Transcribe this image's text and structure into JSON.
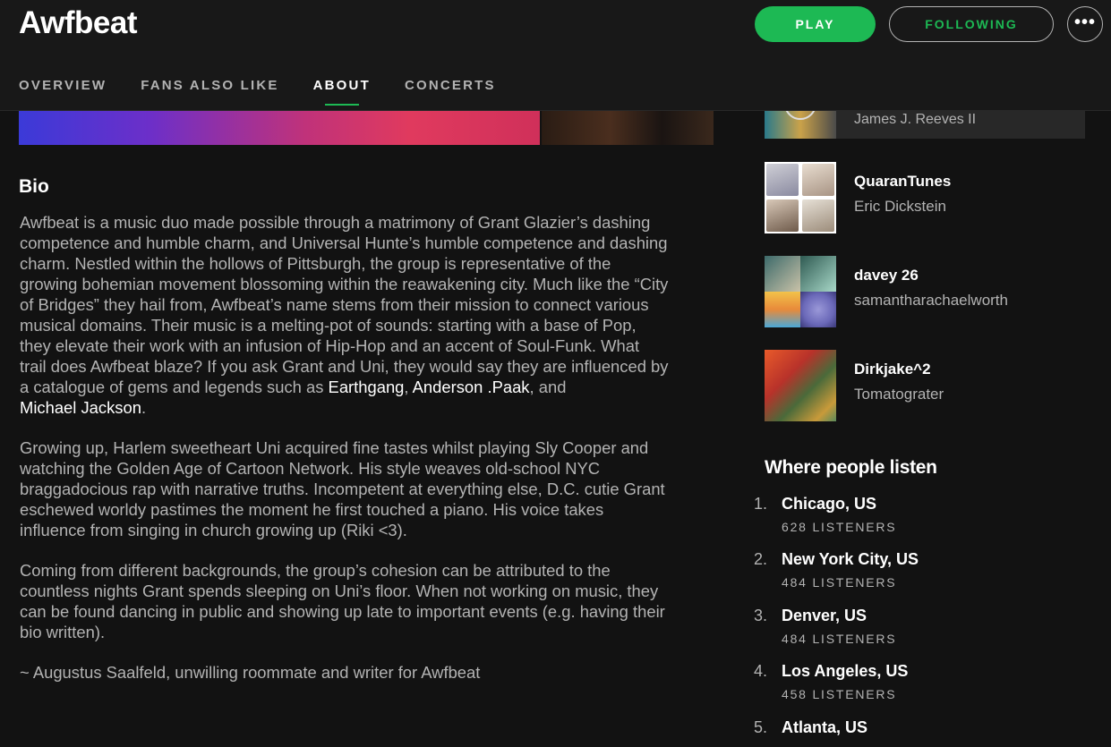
{
  "header": {
    "artist_name": "Awfbeat",
    "play_label": "PLAY",
    "follow_label": "FOLLOWING",
    "more_label": "•••"
  },
  "tabs": [
    {
      "label": "OVERVIEW",
      "active": false
    },
    {
      "label": "FANS ALSO LIKE",
      "active": false
    },
    {
      "label": "ABOUT",
      "active": true
    },
    {
      "label": "CONCERTS",
      "active": false
    }
  ],
  "bio": {
    "title": "Bio",
    "p1_text": "Awfbeat is a music duo made possible through a matrimony of Grant Glazier’s dashing competence and humble charm, and Universal Hunte’s humble competence and dashing charm. Nestled within the hollows of Pittsburgh, the group is representative of the growing bohemian movement blossoming within the reawakening city. Much like the “City of Bridges” they hail from, Awfbeat’s name stems from their mission to connect various musical domains. Their music is a melting-pot of sounds: starting with a base of Pop, they elevate their work with an infusion of Hip-Hop and an accent of Soul-Funk. What trail does Awfbeat blaze? If you ask Grant and Uni, they would say they are influenced by a catalogue of gems and legends such as ",
    "link1": "Earthgang",
    "sep1": ", ",
    "link2": "Anderson .Paak",
    "sep2": ", and ",
    "link3": "Michael Jackson",
    "end1": ".",
    "p2": "Growing up, Harlem sweetheart Uni acquired fine tastes whilst playing Sly Cooper and watching the Golden Age of Cartoon Network. His style weaves old-school NYC braggadocious rap with narrative truths. Incompetent at everything else, D.C. cutie Grant eschewed worldy pastimes the moment he first touched a piano. His voice takes influence from singing in church growing up (Riki <3).",
    "p3": "Coming from different backgrounds, the group’s cohesion can be attributed to the countless nights Grant spends sleeping on Uni’s floor. When not working on music, they can be found dancing in public and showing up late to important events (e.g. having their bio written).",
    "p4": "~ Augustus Saalfeld, unwilling roommate and writer for Awfbeat"
  },
  "discovered_on": {
    "partial_item_owner": "James J. Reeves II",
    "items": [
      {
        "name": "QuaranTunes",
        "owner": "Eric Dickstein"
      },
      {
        "name": "davey 26",
        "owner": "samantharachaelworth"
      },
      {
        "name": "Dirkjake^2",
        "owner": "Tomatograter"
      }
    ]
  },
  "where_people_listen": {
    "title": "Where people listen",
    "cities": [
      {
        "rank": "1.",
        "name": "Chicago, US",
        "listeners": "628 LISTENERS"
      },
      {
        "rank": "2.",
        "name": "New York City, US",
        "listeners": "484 LISTENERS"
      },
      {
        "rank": "3.",
        "name": "Denver, US",
        "listeners": "484 LISTENERS"
      },
      {
        "rank": "4.",
        "name": "Los Angeles, US",
        "listeners": "458 LISTENERS"
      },
      {
        "rank": "5.",
        "name": "Atlanta, US",
        "listeners": ""
      }
    ]
  },
  "colors": {
    "accent": "#1db954",
    "background": "#121212",
    "text_secondary": "#b3b3b3"
  }
}
